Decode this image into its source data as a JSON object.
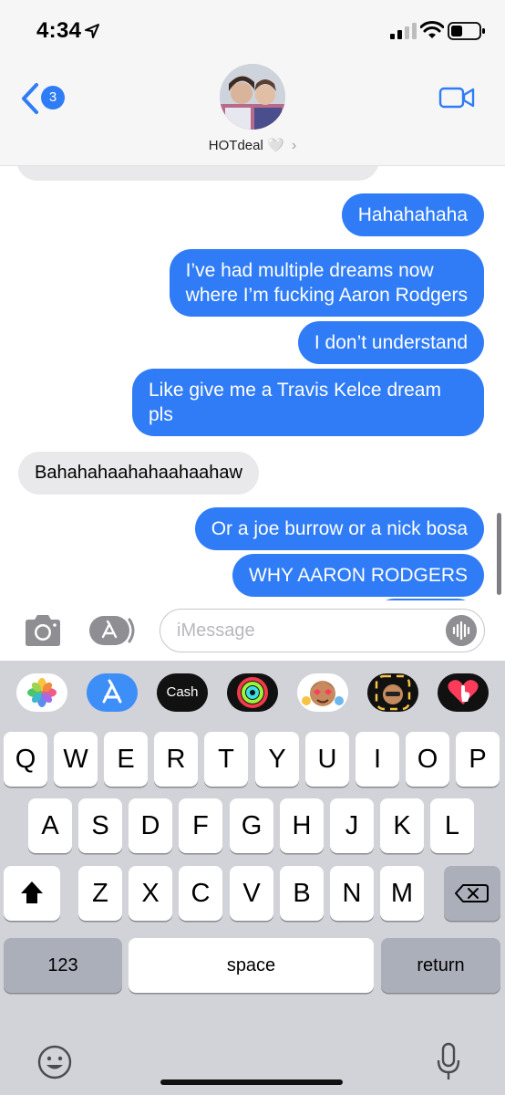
{
  "status_bar": {
    "time": "4:34"
  },
  "header": {
    "back_badge": "3",
    "contact_name": "HOTdeal",
    "contact_emoji": "🤍",
    "chevron": "›"
  },
  "messages": [
    {
      "from": "me",
      "text": "Hahahahaha"
    },
    {
      "from": "me",
      "text_lines": [
        "I’ve had multiple dreams now",
        "where I’m fucking Aaron Rodgers"
      ]
    },
    {
      "from": "me",
      "text": "I don’t understand"
    },
    {
      "from": "me",
      "text_lines": [
        "Like give me a Travis Kelce dream",
        "pls"
      ]
    },
    {
      "from": "them",
      "text": "Bahahahaahahaahaahaw"
    },
    {
      "from": "me",
      "text": "Or a joe burrow or a nick bosa"
    },
    {
      "from": "me",
      "text": "WHY AARON RODGERS"
    }
  ],
  "input": {
    "placeholder": "iMessage"
  },
  "app_strip": [
    "photos-icon",
    "app-store-icon",
    "cash-icon",
    "activity-icon",
    "memoji-icon",
    "memoji-stickers-icon",
    "digital-touch-icon"
  ],
  "app_strip_cash_label": "Cash",
  "keyboard": {
    "row1": [
      "Q",
      "W",
      "E",
      "R",
      "T",
      "Y",
      "U",
      "I",
      "O",
      "P"
    ],
    "row2": [
      "A",
      "S",
      "D",
      "F",
      "G",
      "H",
      "J",
      "K",
      "L"
    ],
    "row3": [
      "Z",
      "X",
      "C",
      "V",
      "B",
      "N",
      "M"
    ],
    "numbers_label": "123",
    "space_label": "space",
    "return_label": "return"
  },
  "colors": {
    "outgoing_bubble": "#2f7cf6",
    "incoming_bubble": "#e9e9eb",
    "keyboard_bg": "#d2d3d8"
  }
}
